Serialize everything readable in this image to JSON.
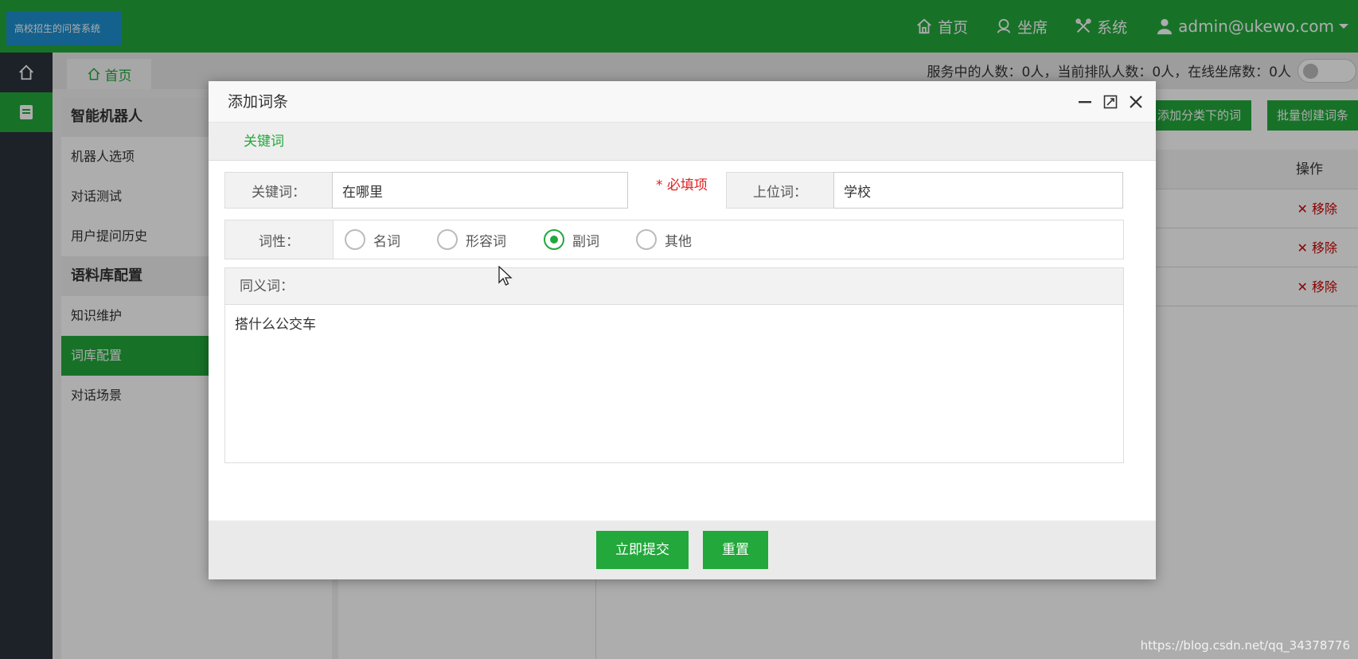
{
  "header": {
    "logo_text": "高校招生的问答系统",
    "nav": {
      "home": "首页",
      "seats": "坐席",
      "system": "系统",
      "user": "admin@ukewo.com"
    }
  },
  "tabs": {
    "home": "首页"
  },
  "status": {
    "text": "服务中的人数：0人，当前排队人数：0人，在线坐席数：0人"
  },
  "menu": {
    "group1": "智能机器人",
    "robot_options": "机器人选项",
    "dialog_test": "对话测试",
    "question_history": "用户提问历史",
    "group2": "语料库配置",
    "knowledge": "知识维护",
    "lexicon": "词库配置",
    "scenes": "对话场景"
  },
  "background": {
    "btn_add_category": "添加分类下的词条",
    "btn_batch_create": "批量创建词条",
    "col_action": "操作",
    "remove_label": "✕ 移除"
  },
  "dialog": {
    "title": "添加词条",
    "tab_keyword": "关键词",
    "keyword_label": "关键词：",
    "keyword_value": "在哪里",
    "required_note": "* 必填项",
    "hypernym_label": "上位词：",
    "hypernym_value": "学校",
    "pos_label": "词性：",
    "pos_options": [
      "名词",
      "形容词",
      "副词",
      "其他"
    ],
    "pos_selected": "副词",
    "synonym_label": "同义词：",
    "synonym_value": "搭什么公交车",
    "submit": "立即提交",
    "reset": "重置"
  },
  "watermark": "https://blog.csdn.net/qq_34378776",
  "colors": {
    "brand_green": "#22a83b",
    "logo_blue": "#1f8fd0",
    "rail_dark": "#2b323c",
    "required_red": "#e02020"
  }
}
